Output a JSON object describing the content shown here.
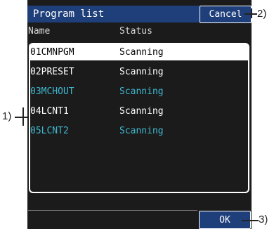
{
  "window": {
    "title": "Program list",
    "cancel_label": "Cancel",
    "ok_label": "OK"
  },
  "columns": {
    "name": "Name",
    "status": "Status"
  },
  "programs": [
    {
      "name": "01CMNPGM",
      "status": "Scanning",
      "selected": true,
      "color": "#000000"
    },
    {
      "name": "02PRESET",
      "status": "Scanning",
      "selected": false,
      "color": "#ffffff"
    },
    {
      "name": "03MCHOUT",
      "status": "Scanning",
      "selected": false,
      "color": "#3fb8d0"
    },
    {
      "name": "04LCNT1",
      "status": "Scanning",
      "selected": false,
      "color": "#ffffff"
    },
    {
      "name": "05LCNT2",
      "status": "Scanning",
      "selected": false,
      "color": "#3fb8d0"
    }
  ],
  "callouts": {
    "list": "1)",
    "cancel": "2)",
    "ok": "3)"
  },
  "colors": {
    "panel_bg": "#1b1b1b",
    "title_bar": "#1f3f7a",
    "highlight_cyan": "#3fb8d0",
    "selection_bg": "#ffffff"
  }
}
